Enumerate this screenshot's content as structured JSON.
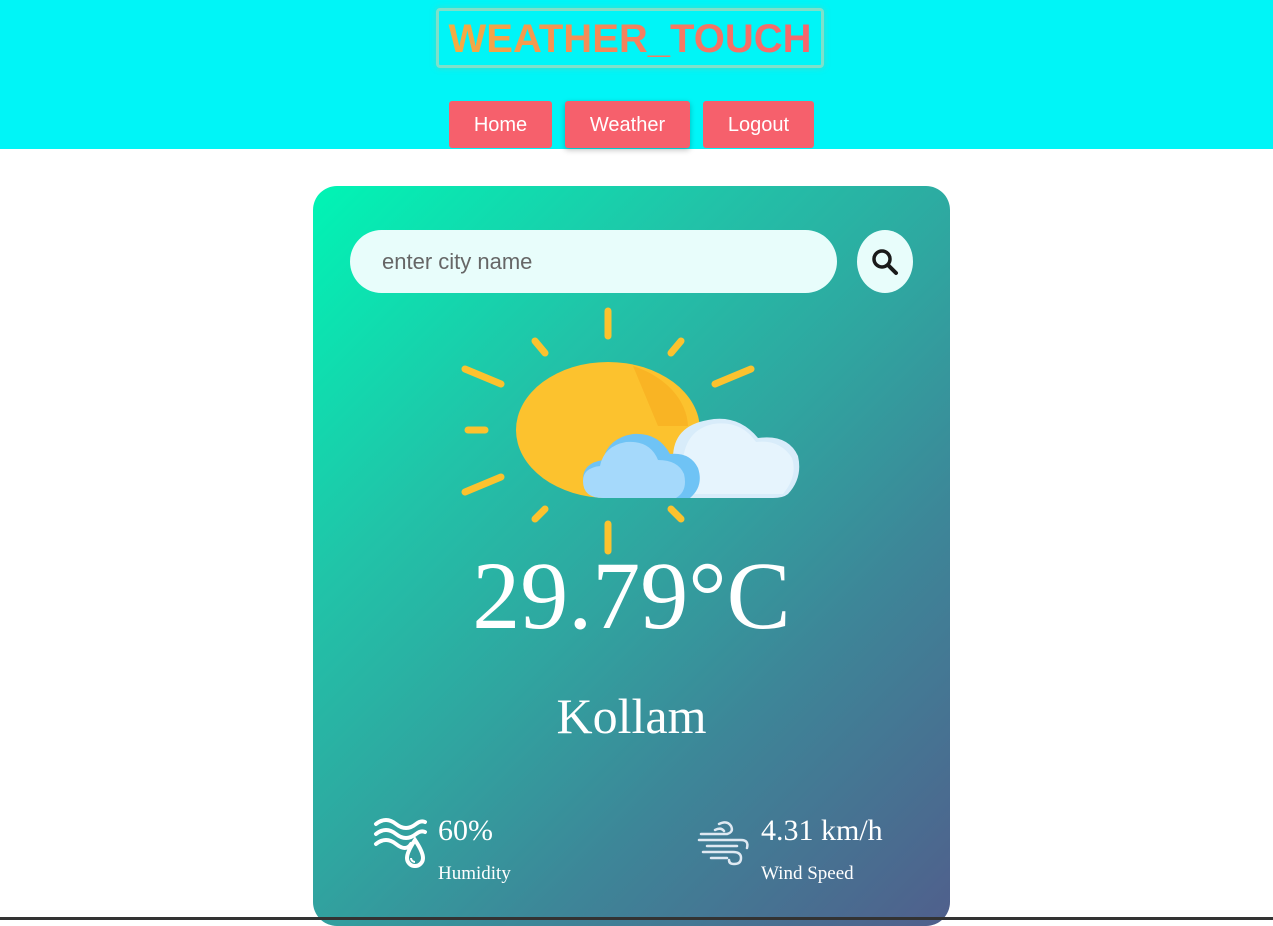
{
  "header": {
    "logo": "WEATHER_TOUCH",
    "nav": {
      "home": "Home",
      "weather": "Weather",
      "logout": "Logout"
    }
  },
  "search": {
    "placeholder": "enter city name",
    "value": ""
  },
  "weather": {
    "icon": "partly-cloudy-icon",
    "temperature": "29.79°C",
    "city": "Kollam",
    "humidity": {
      "value": "60%",
      "label": "Humidity",
      "icon": "humidity-icon"
    },
    "wind": {
      "value": "4.31 km/h",
      "label": "Wind Speed",
      "icon": "wind-icon"
    }
  },
  "colors": {
    "header_bg": "#00f5f7",
    "nav_button": "#f6606c",
    "card_gradient_start": "#00f5b5",
    "card_gradient_end": "#505f8c"
  }
}
